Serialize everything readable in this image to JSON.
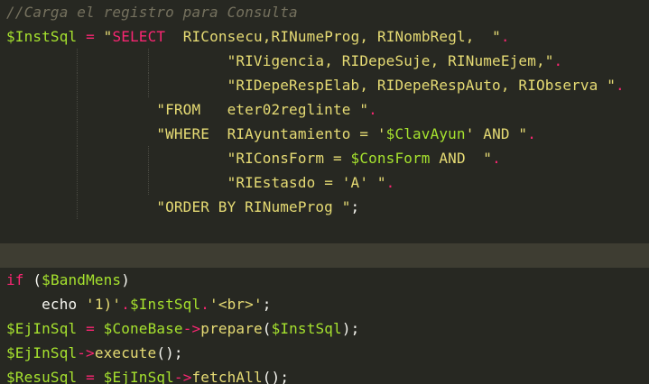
{
  "editor": {
    "theme_colors": {
      "background": "#272822",
      "current_line": "#3e3d32",
      "comment": "#75715e",
      "variable": "#a6e22e",
      "operator": "#f92672",
      "string": "#e6db74",
      "plain": "#f8f8f2",
      "function": "#fd971f"
    },
    "current_line_index": 10,
    "lines": [
      {
        "tokens": [
          {
            "t": "comment",
            "v": "//Carga el registro para Consulta"
          }
        ]
      },
      {
        "tokens": [
          {
            "t": "var",
            "v": "$InstSql"
          },
          {
            "t": "plain",
            "v": " "
          },
          {
            "t": "op",
            "v": "="
          },
          {
            "t": "plain",
            "v": " "
          },
          {
            "t": "str",
            "v": "\""
          },
          {
            "t": "kw",
            "v": "SELECT"
          },
          {
            "t": "str",
            "v": "  RIConsecu,RINumeProg, RINombRegl,  \""
          },
          {
            "t": "op",
            "v": "."
          }
        ]
      },
      {
        "guides": [
          1,
          2
        ],
        "tokens": [
          {
            "t": "plain",
            "v": "                         "
          },
          {
            "t": "str",
            "v": "\"RIVigencia, RIDepeSuje, RINumeEjem,\""
          },
          {
            "t": "op",
            "v": "."
          }
        ]
      },
      {
        "guides": [
          1,
          2
        ],
        "tokens": [
          {
            "t": "plain",
            "v": "                         "
          },
          {
            "t": "str",
            "v": "\"RIDepeRespElab, RIDepeRespAuto, RIObserva \""
          },
          {
            "t": "op",
            "v": "."
          }
        ]
      },
      {
        "guides": [
          1
        ],
        "tokens": [
          {
            "t": "plain",
            "v": "                 "
          },
          {
            "t": "str",
            "v": "\"FROM   eter02reglinte \""
          },
          {
            "t": "op",
            "v": "."
          }
        ]
      },
      {
        "guides": [
          1
        ],
        "tokens": [
          {
            "t": "plain",
            "v": "                 "
          },
          {
            "t": "str",
            "v": "\"WHERE  RIAyuntamiento = '"
          },
          {
            "t": "var",
            "v": "$ClavAyun"
          },
          {
            "t": "str",
            "v": "' AND \""
          },
          {
            "t": "op",
            "v": "."
          }
        ]
      },
      {
        "guides": [
          1,
          2
        ],
        "tokens": [
          {
            "t": "plain",
            "v": "                         "
          },
          {
            "t": "str",
            "v": "\"RIConsForm = "
          },
          {
            "t": "var",
            "v": "$ConsForm"
          },
          {
            "t": "str",
            "v": " AND  \""
          },
          {
            "t": "op",
            "v": "."
          }
        ]
      },
      {
        "guides": [
          1,
          2
        ],
        "tokens": [
          {
            "t": "plain",
            "v": "                         "
          },
          {
            "t": "str",
            "v": "\"RIEstasdo = 'A' \""
          },
          {
            "t": "op",
            "v": "."
          }
        ]
      },
      {
        "guides": [
          1
        ],
        "tokens": [
          {
            "t": "plain",
            "v": "                 "
          },
          {
            "t": "str",
            "v": "\"ORDER BY RINumeProg \""
          },
          {
            "t": "plain",
            "v": ";"
          }
        ]
      },
      {
        "tokens": [
          {
            "t": "plain",
            "v": ""
          }
        ]
      },
      {
        "tokens": [
          {
            "t": "plain",
            "v": ""
          }
        ]
      },
      {
        "tokens": [
          {
            "t": "kw",
            "v": "if"
          },
          {
            "t": "plain",
            "v": " ("
          },
          {
            "t": "var",
            "v": "$BandMens"
          },
          {
            "t": "plain",
            "v": ")"
          }
        ]
      },
      {
        "tokens": [
          {
            "t": "plain",
            "v": "    echo "
          },
          {
            "t": "str",
            "v": "'1)'"
          },
          {
            "t": "op",
            "v": "."
          },
          {
            "t": "var",
            "v": "$InstSql"
          },
          {
            "t": "op",
            "v": "."
          },
          {
            "t": "str",
            "v": "'<br>'"
          },
          {
            "t": "plain",
            "v": ";"
          }
        ]
      },
      {
        "tokens": [
          {
            "t": "var",
            "v": "$EjInSql"
          },
          {
            "t": "plain",
            "v": " "
          },
          {
            "t": "op",
            "v": "="
          },
          {
            "t": "plain",
            "v": " "
          },
          {
            "t": "var",
            "v": "$ConeBase"
          },
          {
            "t": "op",
            "v": "->"
          },
          {
            "t": "fn",
            "v": "prepare"
          },
          {
            "t": "plain",
            "v": "("
          },
          {
            "t": "var",
            "v": "$InstSql"
          },
          {
            "t": "plain",
            "v": ");"
          }
        ]
      },
      {
        "tokens": [
          {
            "t": "var",
            "v": "$EjInSql"
          },
          {
            "t": "op",
            "v": "->"
          },
          {
            "t": "fn",
            "v": "execute"
          },
          {
            "t": "plain",
            "v": "();"
          }
        ]
      },
      {
        "tokens": [
          {
            "t": "var",
            "v": "$ResuSql"
          },
          {
            "t": "plain",
            "v": " "
          },
          {
            "t": "op",
            "v": "="
          },
          {
            "t": "plain",
            "v": " "
          },
          {
            "t": "var",
            "v": "$EjInSql"
          },
          {
            "t": "op",
            "v": "->"
          },
          {
            "t": "fn",
            "v": "fetchAll"
          },
          {
            "t": "plain",
            "v": "();"
          }
        ]
      }
    ]
  }
}
